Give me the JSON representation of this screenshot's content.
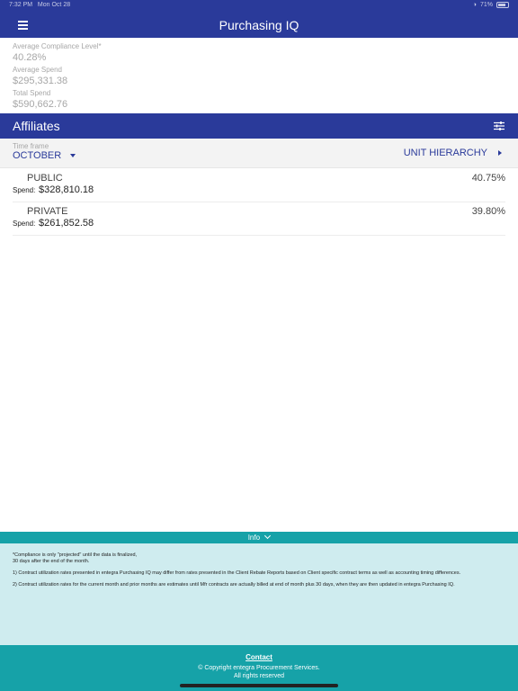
{
  "status": {
    "time": "7:32 PM",
    "date": "Mon Oct 28",
    "battery": "71%"
  },
  "app": {
    "title": "Purchasing IQ"
  },
  "summary": {
    "avg_compliance_label": "Average Compliance Level*",
    "avg_compliance_value": "40.28%",
    "avg_spend_label": "Average Spend",
    "avg_spend_value": "$295,331.38",
    "total_spend_label": "Total Spend",
    "total_spend_value": "$590,662.76"
  },
  "affiliates": {
    "title": "Affiliates"
  },
  "timeframe": {
    "label": "Time frame",
    "month": "OCTOBER",
    "hierarchy": "UNIT HIERARCHY"
  },
  "rows": [
    {
      "name": "PUBLIC",
      "percent": "40.75%",
      "spend_label": "Spend:",
      "spend": "$328,810.18"
    },
    {
      "name": "PRIVATE",
      "percent": "39.80%",
      "spend_label": "Spend:",
      "spend": "$261,852.58"
    }
  ],
  "info": {
    "label": "Info",
    "note": "*Compliance is only \"projected\" until the data is finalized, 30 days after the end of the month.",
    "item1": "1)      Contract utilization rates presented in entegra Purchasing IQ may differ from rates presented in the Client Rebate Reports based on Client specific contract terms as well as accounting timing differences.",
    "item2": "2)      Contract utilization rates for the current month and prior months are estimates until Mfr contracts are actually billed at end of month plus 30 days, when they are then updated in entegra Purchasing IQ."
  },
  "footer": {
    "contact": "Contact",
    "copyright": "© Copyright entegra Procurement Services.",
    "rights": "All rights reserved"
  }
}
